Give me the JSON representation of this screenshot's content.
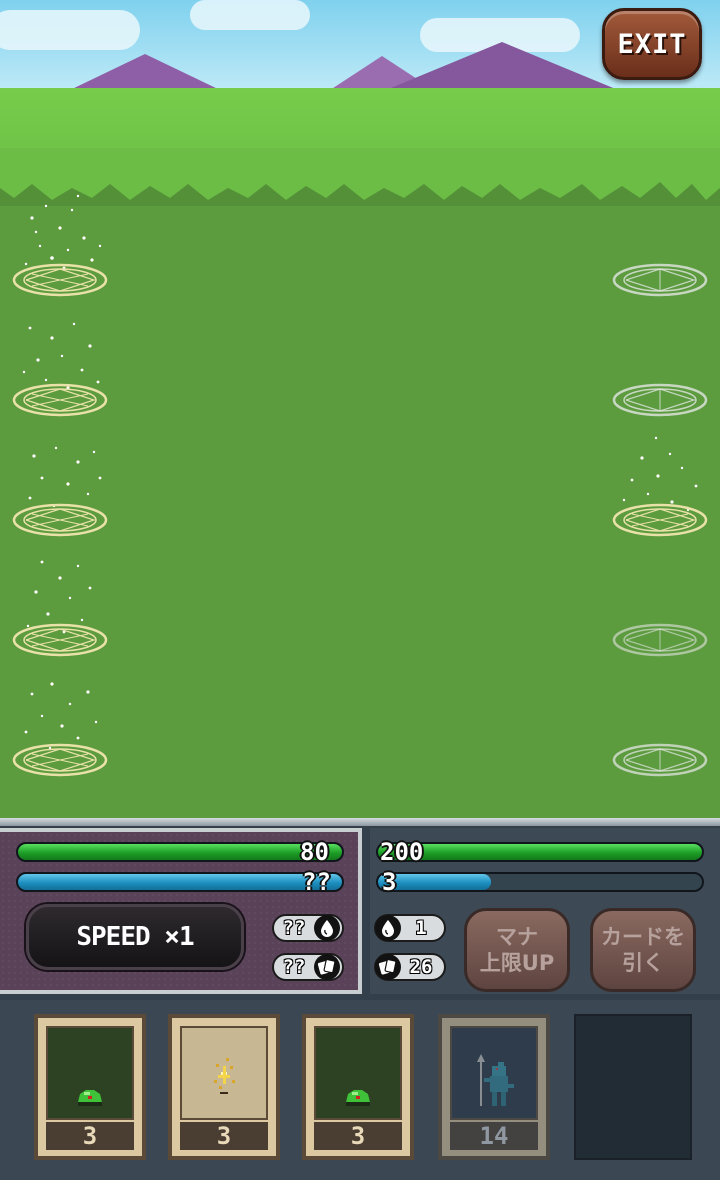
{
  "top_bar": {
    "exit_label": "EXIT"
  },
  "player": {
    "hp": "80",
    "hp_fill": 1.0,
    "mana": "??",
    "mana_fill": 1.0,
    "speed_label": "SPEED ×1",
    "mana_regen": "??",
    "deck_count": "??"
  },
  "enemy": {
    "hp": "200",
    "hp_fill": 1.0,
    "mana": "3",
    "mana_fill": 0.35,
    "mana_regen": "1",
    "deck_count": "26"
  },
  "buttons": {
    "mana_up_line1": "マナ",
    "mana_up_line2": "上限UP",
    "draw_line1": "カードを",
    "draw_line2": "引く"
  },
  "hand": [
    {
      "creature": "green-slime",
      "cost": "3"
    },
    {
      "creature": "fire-sprite",
      "cost": "3"
    },
    {
      "creature": "green-slime",
      "cost": "3"
    },
    {
      "creature": "blue-lizardman",
      "cost": "14"
    }
  ],
  "icons": [
    "mana-drop-icon",
    "cards-icon"
  ],
  "colors": {
    "hp": "#1d9e26",
    "mana": "#1d8fc0",
    "exit": "#8a4428"
  }
}
